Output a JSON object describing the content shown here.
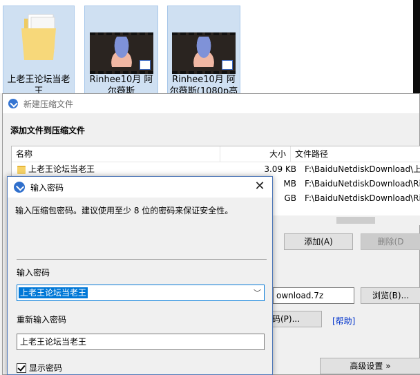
{
  "desktop": {
    "files": [
      {
        "label": "上老王论坛当老",
        "label2": "王",
        "kind": "folder"
      },
      {
        "label": "Rinhee10月 阿",
        "label2": "尔薇斯",
        "kind": "video"
      },
      {
        "label": "Rinhee10月 阿",
        "label2": "尔薇斯(1080p高",
        "kind": "video"
      }
    ]
  },
  "main_window": {
    "title": "新建压缩文件",
    "section_heading": "添加文件到压缩文件",
    "columns": {
      "name": "名称",
      "size": "大小",
      "path": "文件路径"
    },
    "rows": [
      {
        "name": "上老王论坛当老王",
        "size": "3.09 KB",
        "path": "F:\\BaiduNetdiskDownload\\上老王"
      },
      {
        "name": "",
        "size": "MB",
        "path": "F:\\BaiduNetdiskDownload\\Rinhee"
      },
      {
        "name": "",
        "size": "GB",
        "path": "F:\\BaiduNetdiskDownload\\Rinhee"
      }
    ],
    "add_button": "添加(A)",
    "delete_button": "删除(D",
    "archive_path": "ownload.7z",
    "browse_button": "浏览(B)...",
    "password_button": "码(P)...",
    "help_link": "[帮助]",
    "advanced_button": "高级设置 »"
  },
  "dialog": {
    "title": "输入密码",
    "description": "输入压缩包密码。建议使用至少 8 位的密码来保证安全性。",
    "label_password": "输入密码",
    "password_value": "上老王论坛当老王",
    "label_reenter": "重新输入密码",
    "reenter_value": "上老王论坛当老王",
    "show_password_label": "显示密码",
    "show_password_checked": true
  }
}
